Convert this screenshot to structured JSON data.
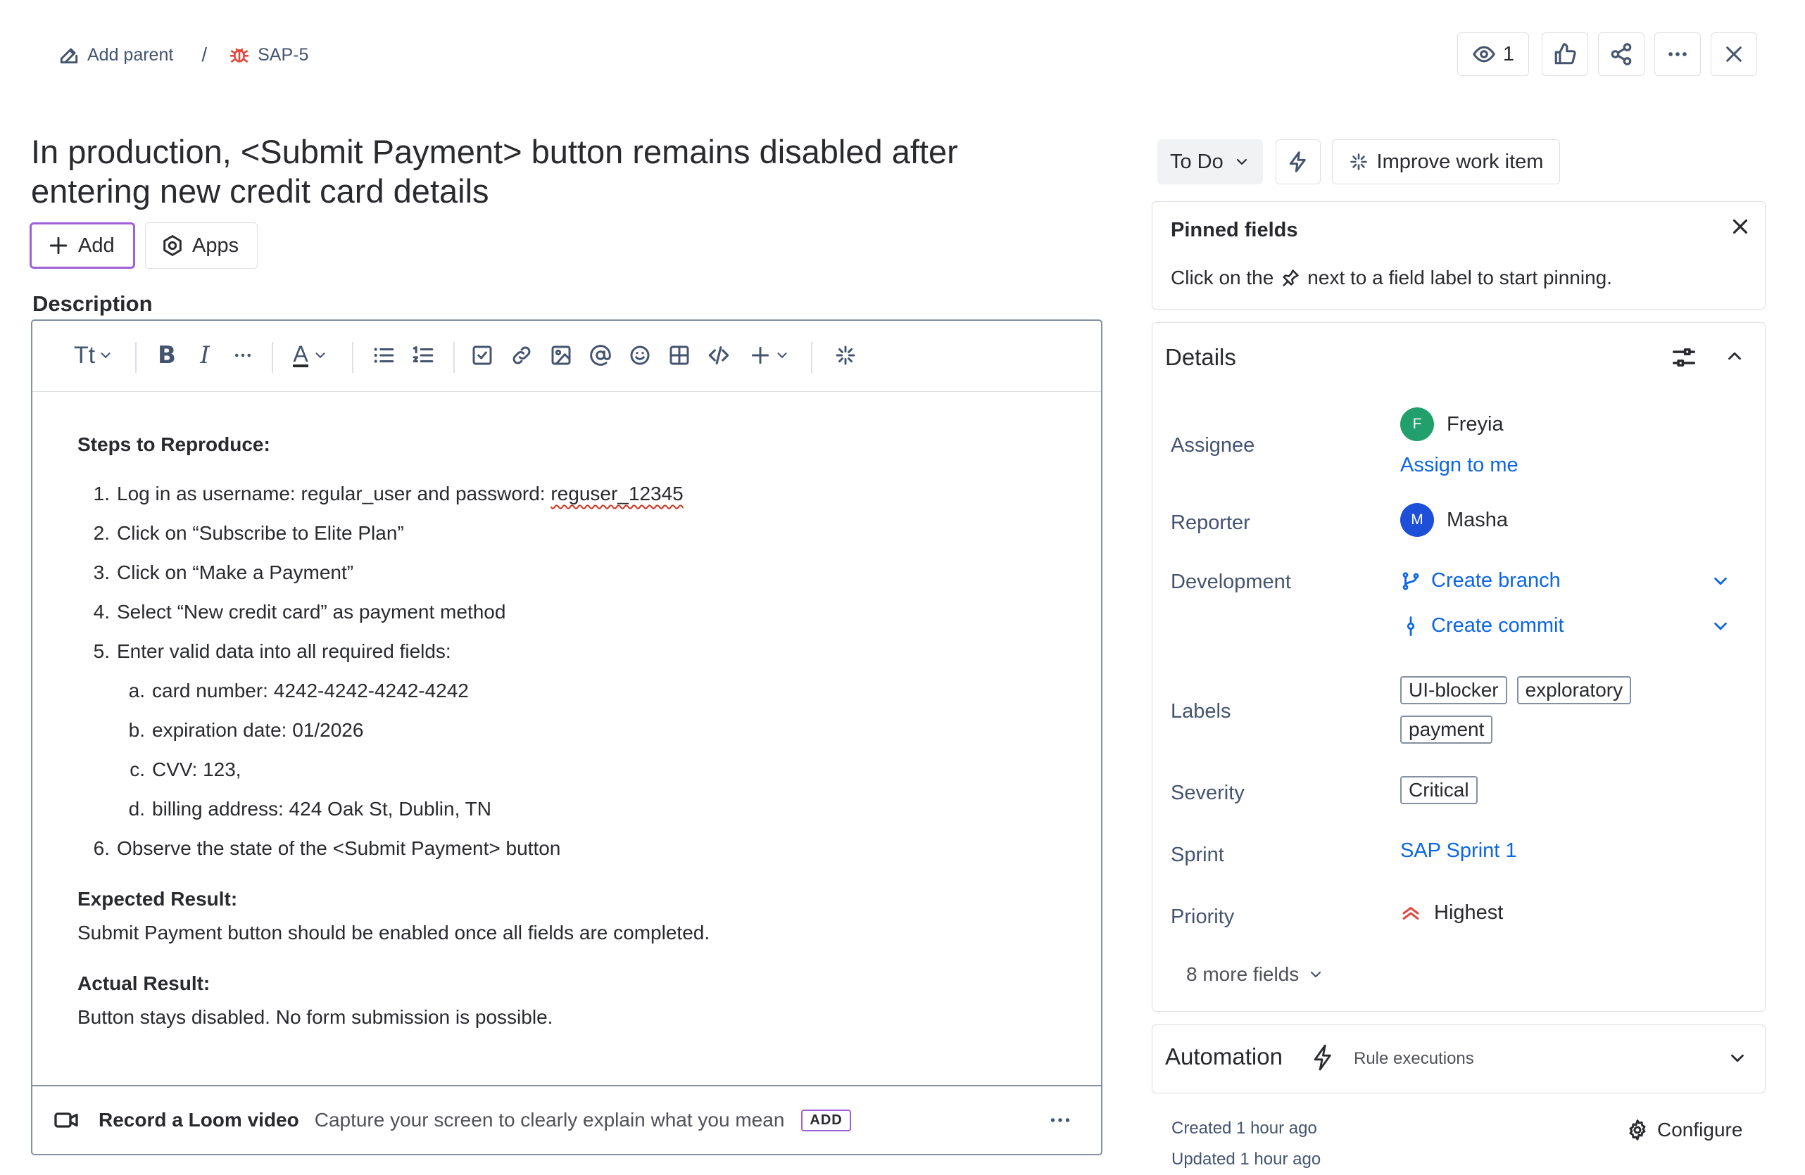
{
  "breadcrumb": {
    "add_parent": "Add parent",
    "separator": "/",
    "issue_key": "SAP-5"
  },
  "top_actions": {
    "watchers_count": "1"
  },
  "issue": {
    "title": "In production, <Submit Payment> button remains disabled after entering new credit card details",
    "add_label": "Add",
    "apps_label": "Apps"
  },
  "description": {
    "label": "Description",
    "toolbar": {
      "text_style": "Tt",
      "text_color": "A"
    },
    "steps_heading": "Steps to Reproduce:",
    "steps": [
      {
        "num": "1.",
        "text": "Log in as username: regular_user and password: ",
        "extra": "reguser_12345"
      },
      {
        "num": "2.",
        "text": "Click on “Subscribe to Elite Plan”"
      },
      {
        "num": "3.",
        "text": "Click on “Make a Payment”"
      },
      {
        "num": "4.",
        "text": "Select “New credit card” as payment method"
      },
      {
        "num": "5.",
        "text": "Enter valid data into all required fields:"
      },
      {
        "num": "6.",
        "text": "Observe the state of the <Submit Payment> button"
      }
    ],
    "substeps": [
      {
        "num": "a.",
        "text": "card number: 4242-4242-4242-4242"
      },
      {
        "num": "b.",
        "text": "expiration date: 01/2026"
      },
      {
        "num": "c.",
        "text": "CVV: 123,"
      },
      {
        "num": "d.",
        "text": "billing address: 424 Oak St, Dublin, TN"
      }
    ],
    "expected_heading": "Expected Result:",
    "expected_text": "Submit Payment button should be enabled once all fields are completed.",
    "actual_heading": "Actual Result:",
    "actual_text": "Button stays disabled. No form submission is possible.",
    "loom": {
      "title": "Record a Loom video",
      "subtitle": "Capture your screen to clearly explain what you mean",
      "badge": "ADD"
    }
  },
  "status": {
    "label": "To Do",
    "improve_label": "Improve work item"
  },
  "pinned": {
    "title": "Pinned fields",
    "hint_before": "Click on the",
    "hint_after": "next to a field label to start pinning."
  },
  "details": {
    "title": "Details",
    "assignee": {
      "label": "Assignee",
      "initial": "F",
      "name": "Freyia",
      "assign_to_me": "Assign to me",
      "color": "#22a06b"
    },
    "reporter": {
      "label": "Reporter",
      "initial": "M",
      "name": "Masha",
      "color": "#1d4fd8"
    },
    "development": {
      "label": "Development",
      "create_branch": "Create branch",
      "create_commit": "Create commit"
    },
    "labels": {
      "label": "Labels",
      "items": [
        "UI-blocker",
        "exploratory",
        "payment"
      ]
    },
    "severity": {
      "label": "Severity",
      "value": "Critical"
    },
    "sprint": {
      "label": "Sprint",
      "value": "SAP Sprint 1"
    },
    "priority": {
      "label": "Priority",
      "value": "Highest",
      "color": "#e2483d"
    },
    "more_fields": "8 more fields"
  },
  "automation": {
    "title": "Automation",
    "subtitle": "Rule executions"
  },
  "meta": {
    "created": "Created 1 hour ago",
    "updated": "Updated 1 hour ago",
    "configure": "Configure"
  },
  "colors": {
    "link": "#0c66e4",
    "focus": "#9f5fd9",
    "bug": "#e2483d"
  }
}
